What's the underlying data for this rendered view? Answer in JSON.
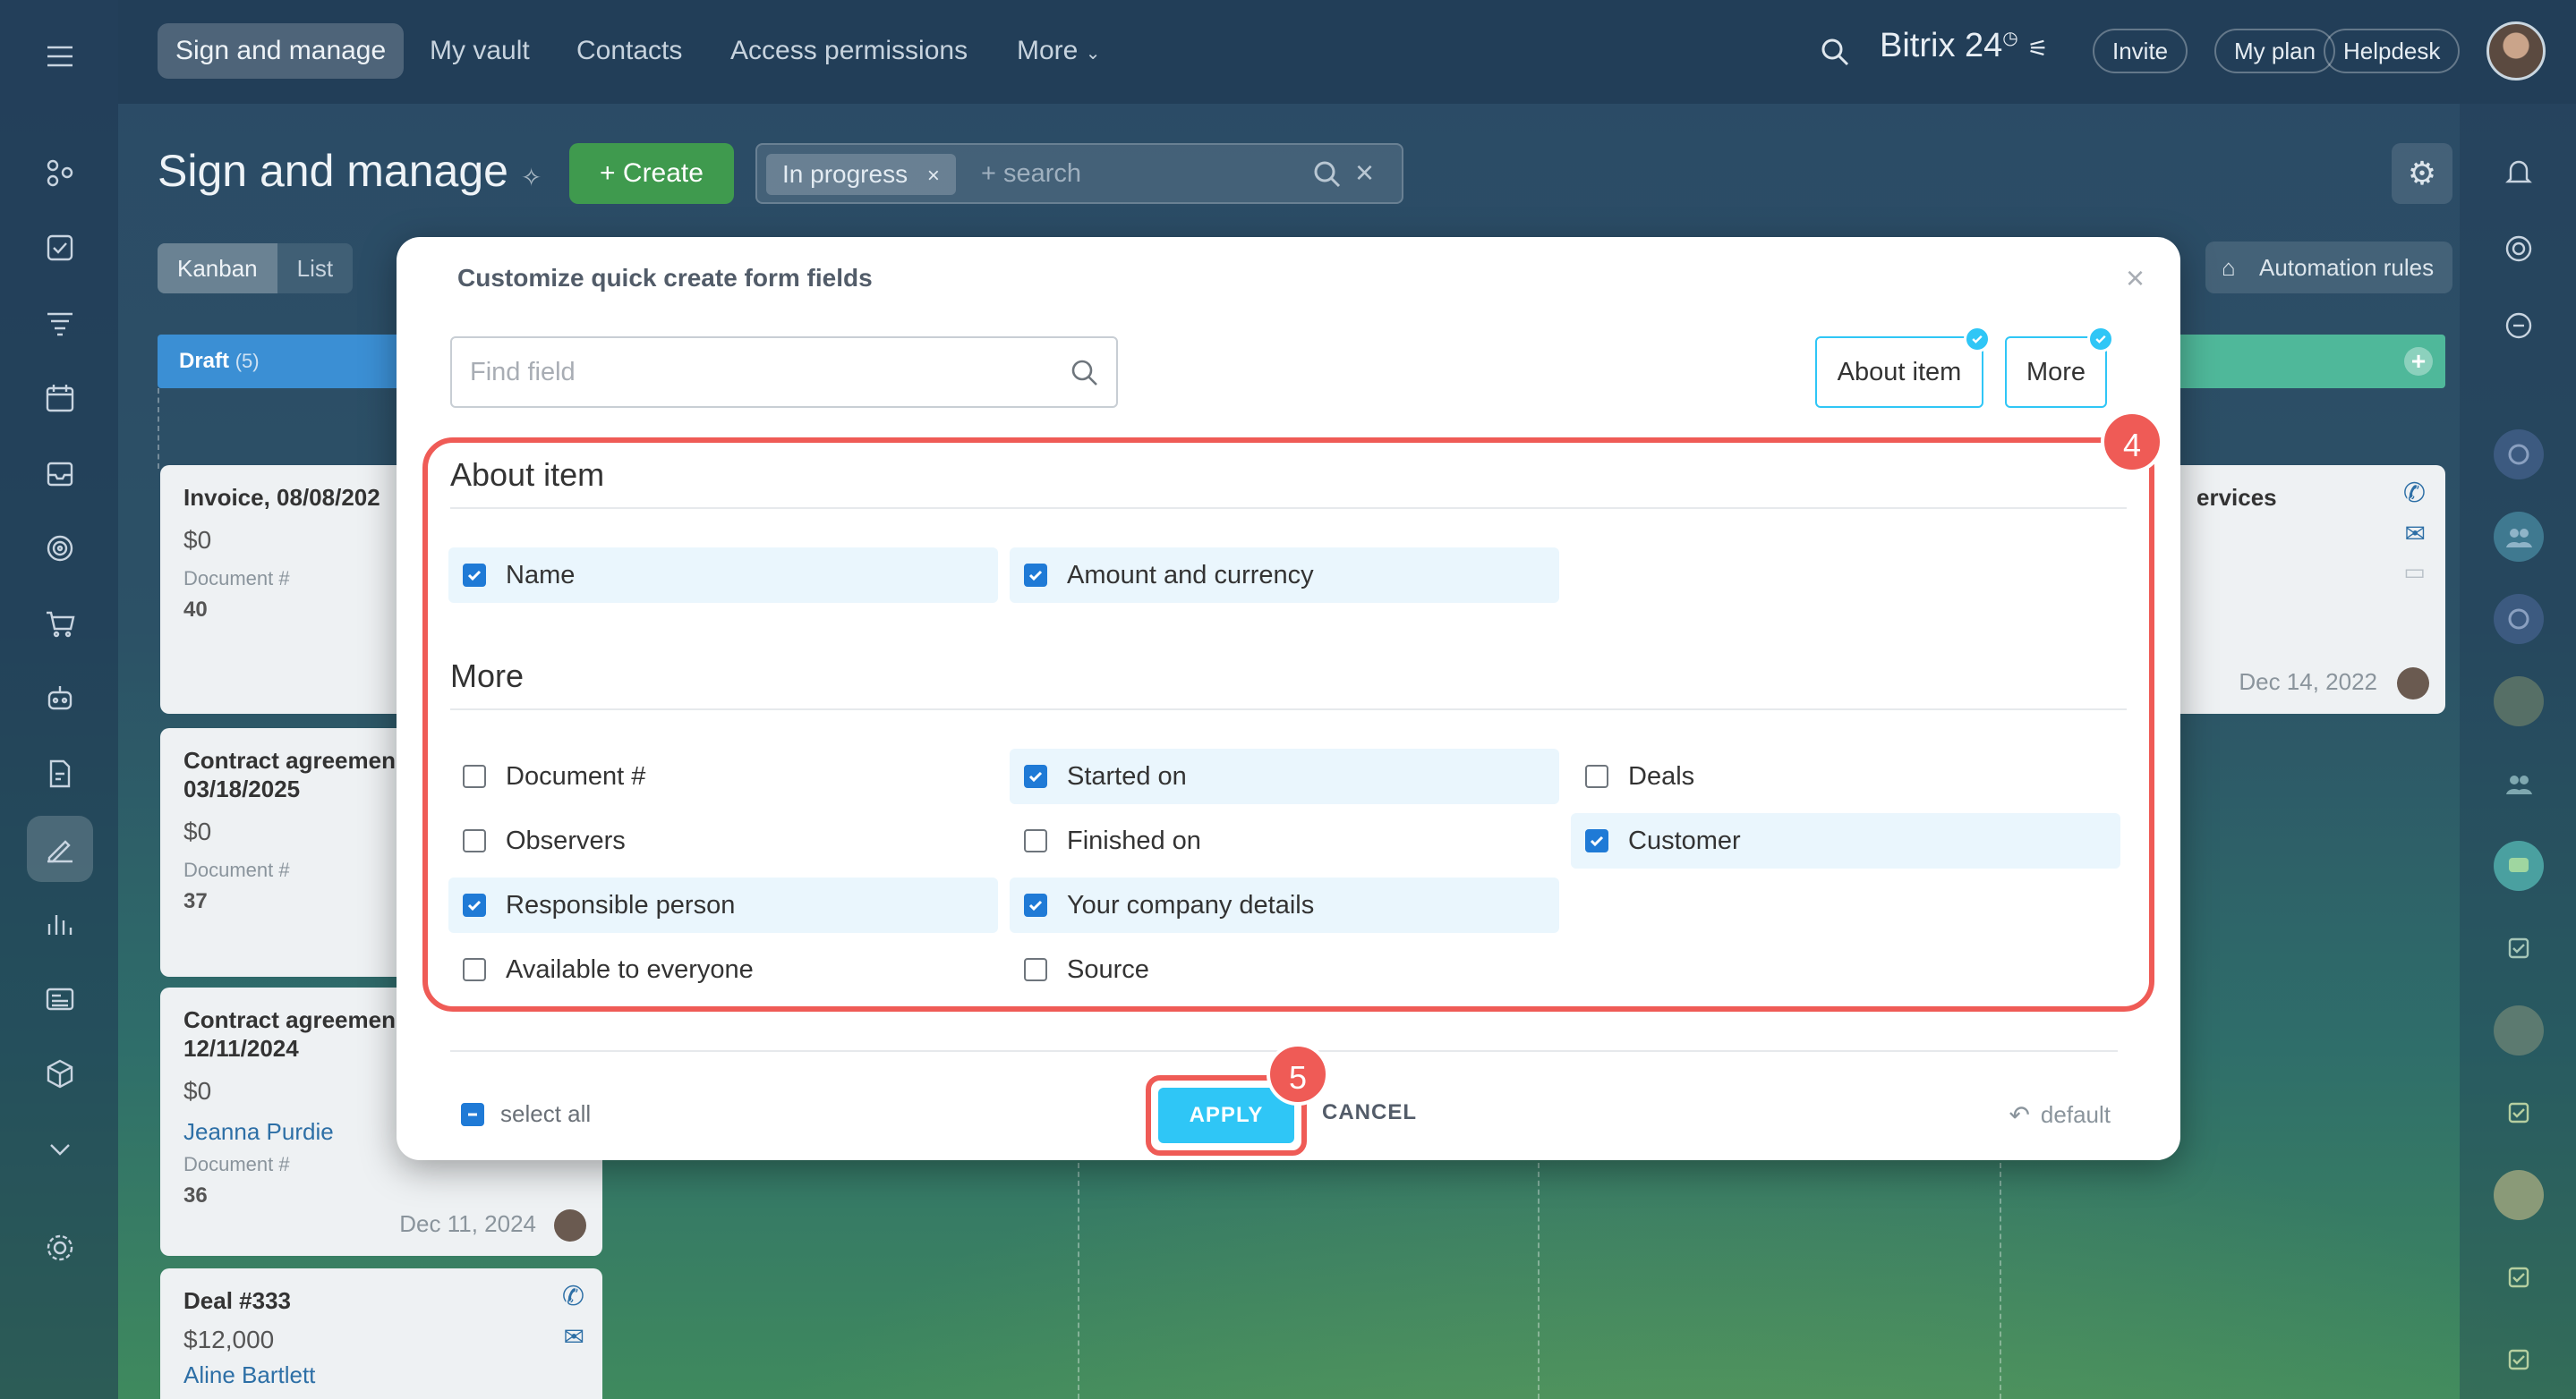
{
  "topbar": {
    "tabs": [
      "Sign and manage",
      "My vault",
      "Contacts",
      "Access permissions",
      "More"
    ],
    "brand": "Bitrix 24",
    "invite": "Invite",
    "my_plan": "My plan",
    "helpdesk": "Helpdesk"
  },
  "page": {
    "title": "Sign and manage",
    "create_label": "+ Create",
    "filter_chip": "In progress",
    "search_placeholder": "+ search",
    "view_tabs": [
      "Kanban",
      "List"
    ],
    "automation_label": "Automation rules"
  },
  "kanban": {
    "column_draft": "Draft",
    "column_draft_count": "(5)",
    "cards": [
      {
        "title": "Invoice, 08/08/202",
        "amount": "$0",
        "doc_label": "Document #",
        "doc_num": "40"
      },
      {
        "title": "Contract agreemen 03/18/2025",
        "amount": "$0",
        "doc_label": "Document #",
        "doc_num": "37"
      },
      {
        "title": "Contract agreemen 12/11/2024",
        "amount": "$0",
        "person": "Jeanna Purdie",
        "doc_label": "Document #",
        "doc_num": "36",
        "date": "Dec 11, 2024"
      },
      {
        "title": "Deal #333",
        "amount": "$12,000",
        "person": "Aline Bartlett"
      }
    ],
    "right_card": {
      "title": "ervices",
      "date": "Dec 14, 2022"
    }
  },
  "modal": {
    "title": "Customize quick create form fields",
    "find_placeholder": "Find field",
    "section_buttons": [
      "About item",
      "More"
    ],
    "sections": [
      {
        "title": "About item",
        "fields": [
          {
            "label": "Name",
            "checked": true
          },
          {
            "label": "Amount and currency",
            "checked": true
          }
        ]
      },
      {
        "title": "More",
        "fields": [
          {
            "label": "Document #",
            "checked": false
          },
          {
            "label": "Started on",
            "checked": true
          },
          {
            "label": "Deals",
            "checked": false
          },
          {
            "label": "Observers",
            "checked": false
          },
          {
            "label": "Finished on",
            "checked": false
          },
          {
            "label": "Customer",
            "checked": true
          },
          {
            "label": "Responsible person",
            "checked": true
          },
          {
            "label": "Your company details",
            "checked": true
          },
          {
            "label": "Available to everyone",
            "checked": false
          },
          {
            "label": "Source",
            "checked": false
          }
        ]
      }
    ],
    "select_all": "select all",
    "apply": "APPLY",
    "cancel": "CANCEL",
    "default": "default",
    "step_badges": [
      "4",
      "5"
    ]
  },
  "colors": {
    "accent": "#2fc6f6",
    "highlight": "#ef5b56",
    "create": "#3f9a4e",
    "checkbox": "#1f7ad6"
  }
}
